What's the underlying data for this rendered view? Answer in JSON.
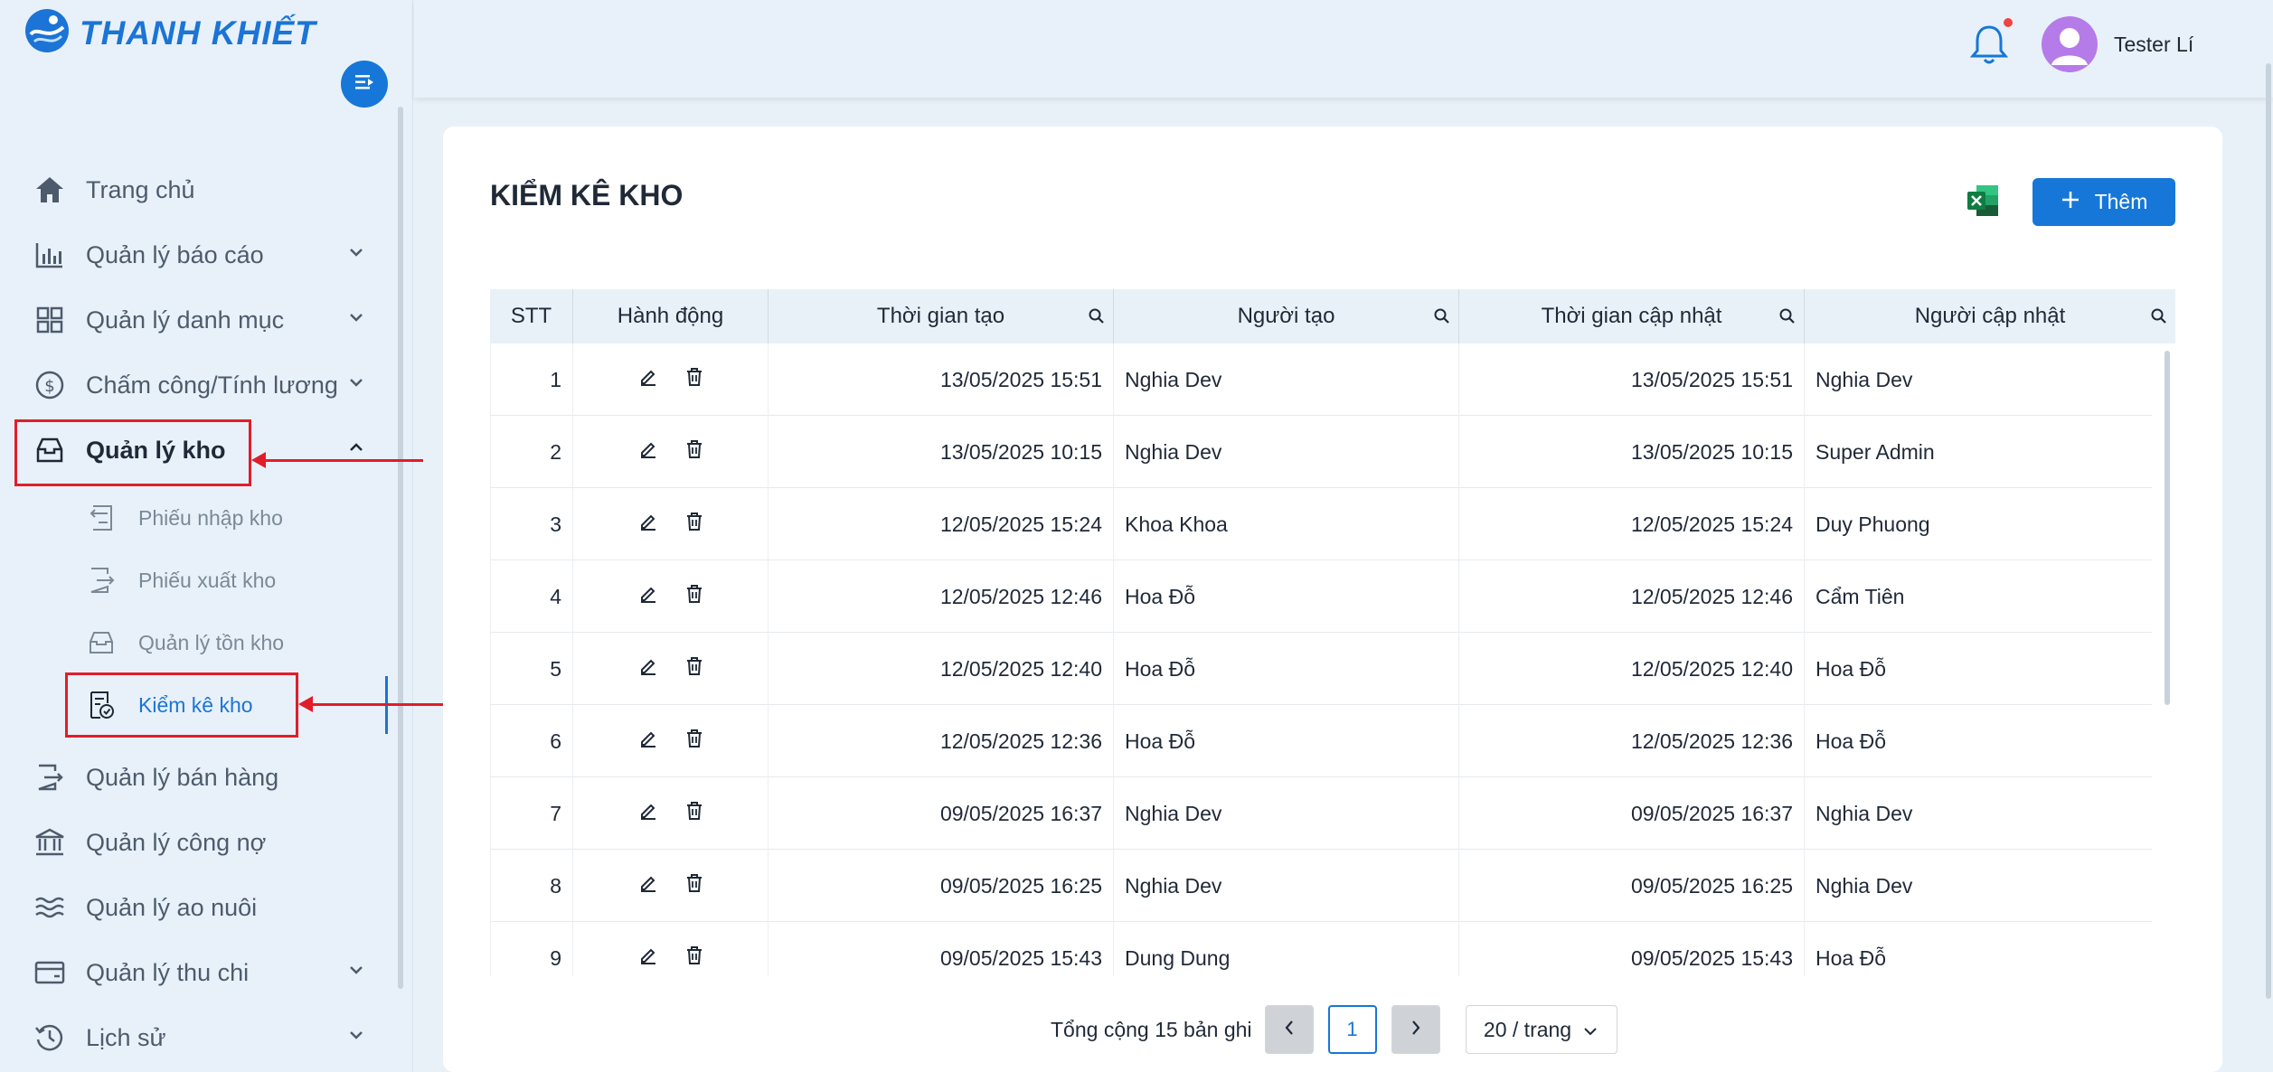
{
  "brand": {
    "name": "THANH KHIẾT"
  },
  "colors": {
    "accent": "#1677d8",
    "highlight": "#e11d2a",
    "active_text": "#1b74d6"
  },
  "sidebar": {
    "items": [
      {
        "label": "Trang chủ",
        "icon": "home-icon"
      },
      {
        "label": "Quản lý báo cáo",
        "icon": "bar-chart-icon"
      },
      {
        "label": "Quản lý danh mục",
        "icon": "grid-icon"
      },
      {
        "label": "Chấm công/Tính lương",
        "icon": "dollar-circle-icon"
      },
      {
        "label": "Quản lý kho",
        "icon": "inbox-icon"
      },
      {
        "label": "Quản lý bán hàng",
        "icon": "transfer-icon"
      },
      {
        "label": "Quản lý công nợ",
        "icon": "bank-icon"
      },
      {
        "label": "Quản lý ao nuôi",
        "icon": "waves-icon"
      },
      {
        "label": "Quản lý thu chi",
        "icon": "wallet-icon"
      },
      {
        "label": "Lịch sử",
        "icon": "history-icon"
      }
    ],
    "subitems": [
      {
        "label": "Phiếu nhập kho",
        "icon": "import-doc-icon"
      },
      {
        "label": "Phiếu xuất kho",
        "icon": "export-doc-icon"
      },
      {
        "label": "Quản lý tồn kho",
        "icon": "inventory-icon"
      },
      {
        "label": "Kiểm kê kho",
        "icon": "audit-doc-icon"
      }
    ]
  },
  "header": {
    "user_name": "Tester Lí"
  },
  "main": {
    "title": "KIỂM KÊ KHO",
    "add_label": "Thêm",
    "columns": [
      "STT",
      "Hành động",
      "Thời gian tạo",
      "Người tạo",
      "Thời gian cập nhật",
      "Người cập nhật"
    ],
    "rows": [
      {
        "stt": "1",
        "created": "13/05/2025 15:51",
        "creator": "Nghia Dev",
        "updated": "13/05/2025 15:51",
        "updater": "Nghia Dev"
      },
      {
        "stt": "2",
        "created": "13/05/2025 10:15",
        "creator": "Nghia Dev",
        "updated": "13/05/2025 10:15",
        "updater": "Super Admin"
      },
      {
        "stt": "3",
        "created": "12/05/2025 15:24",
        "creator": "Khoa Khoa",
        "updated": "12/05/2025 15:24",
        "updater": "Duy Phuong"
      },
      {
        "stt": "4",
        "created": "12/05/2025 12:46",
        "creator": "Hoa Đỗ",
        "updated": "12/05/2025 12:46",
        "updater": "Cẩm Tiên"
      },
      {
        "stt": "5",
        "created": "12/05/2025 12:40",
        "creator": "Hoa Đỗ",
        "updated": "12/05/2025 12:40",
        "updater": "Hoa Đỗ"
      },
      {
        "stt": "6",
        "created": "12/05/2025 12:36",
        "creator": "Hoa Đỗ",
        "updated": "12/05/2025 12:36",
        "updater": "Hoa Đỗ"
      },
      {
        "stt": "7",
        "created": "09/05/2025 16:37",
        "creator": "Nghia Dev",
        "updated": "09/05/2025 16:37",
        "updater": "Nghia Dev"
      },
      {
        "stt": "8",
        "created": "09/05/2025 16:25",
        "creator": "Nghia Dev",
        "updated": "09/05/2025 16:25",
        "updater": "Nghia Dev"
      },
      {
        "stt": "9",
        "created": "09/05/2025 15:43",
        "creator": "Dung Dung",
        "updated": "09/05/2025 15:43",
        "updater": "Hoa Đỗ"
      }
    ],
    "pagination": {
      "total_text": "Tổng cộng 15 bản ghi",
      "current_page": "1",
      "page_size": "20 / trang"
    }
  }
}
